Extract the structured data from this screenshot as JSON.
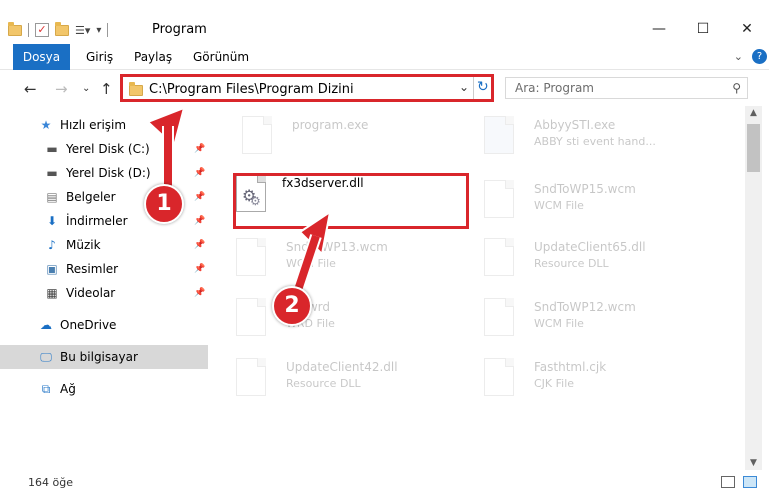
{
  "window": {
    "title": "Program",
    "minimize": "—",
    "maximize": "☐",
    "close": "✕"
  },
  "ribbon": {
    "tabs": [
      "Dosya",
      "Giriş",
      "Paylaş",
      "Görünüm"
    ],
    "help": "?"
  },
  "address": {
    "path": "C:\\Program Files\\Program Dizini",
    "search_placeholder": "Ara: Program"
  },
  "sidebar": {
    "items": [
      {
        "label": "Hızlı erişim",
        "icon": "star-icon"
      },
      {
        "label": "Yerel Disk (C:)",
        "icon": "drive-icon"
      },
      {
        "label": "Yerel Disk (D:)",
        "icon": "drive-icon"
      },
      {
        "label": "Belgeler",
        "icon": "documents-icon"
      },
      {
        "label": "İndirmeler",
        "icon": "download-icon"
      },
      {
        "label": "Müzik",
        "icon": "music-icon"
      },
      {
        "label": "Resimler",
        "icon": "pictures-icon"
      },
      {
        "label": "Videolar",
        "icon": "videos-icon"
      },
      {
        "label": "OneDrive",
        "icon": "cloud-icon"
      },
      {
        "label": "Bu bilgisayar",
        "icon": "computer-icon"
      },
      {
        "label": "Ağ",
        "icon": "network-icon"
      }
    ]
  },
  "files": [
    {
      "name": "program.exe",
      "type": ""
    },
    {
      "name": "AbbyySTI.exe",
      "type": "ABBY sti event hand..."
    },
    {
      "name": "fx3dserver.dll",
      "type": ""
    },
    {
      "name": "SndToWP15.wcm",
      "type": "WCM File"
    },
    {
      "name": "SndToWP13.wcm",
      "type": "WCM File"
    },
    {
      "name": "UpdateClient65.dll",
      "type": "Resource DLL"
    },
    {
      "name": "...c.wrd",
      "type": "WRD File"
    },
    {
      "name": "SndToWP12.wcm",
      "type": "WCM File"
    },
    {
      "name": "UpdateClient42.dll",
      "type": "Resource DLL"
    },
    {
      "name": "Fasthtml.cjk",
      "type": "CJK File"
    }
  ],
  "status": {
    "count": "164 öğe"
  },
  "annotations": {
    "step1": "1",
    "step2": "2"
  },
  "colors": {
    "accent": "#1a6fc4",
    "highlight": "#d9262b"
  }
}
